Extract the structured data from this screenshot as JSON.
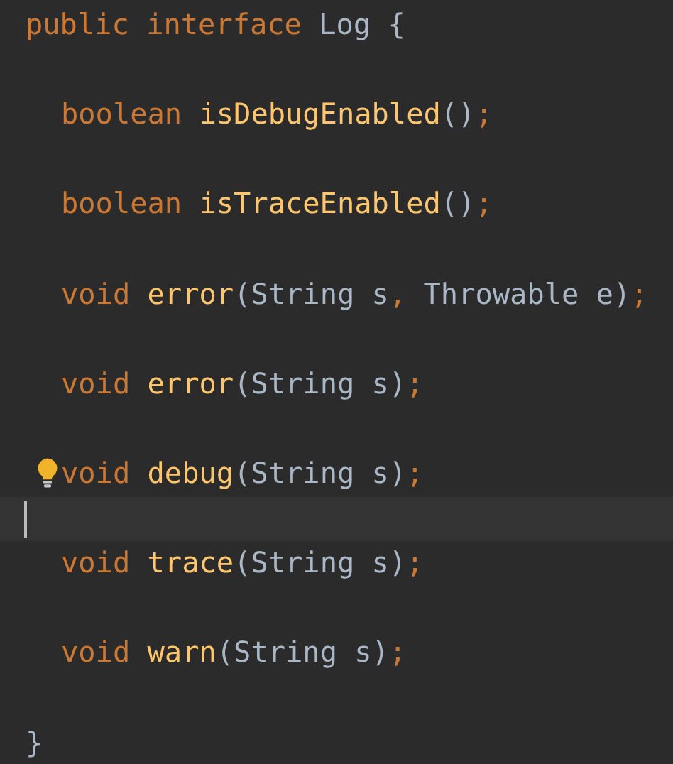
{
  "editor": {
    "lines": [
      {
        "kind": "code",
        "bulb": false,
        "tokens": [
          {
            "kind": "keyword",
            "text": "public interface "
          },
          {
            "kind": "plain",
            "text": "Log {"
          }
        ],
        "children": [
          {
            "kind": "blank"
          },
          {
            "kind": "code",
            "bulb": false,
            "tokens": [
              {
                "kind": "keyword",
                "text": "boolean "
              },
              {
                "kind": "method",
                "text": "isDebugEnabled"
              },
              {
                "kind": "plain",
                "text": "()"
              },
              {
                "kind": "keyword",
                "text": ";"
              }
            ]
          },
          {
            "kind": "blank"
          },
          {
            "kind": "code",
            "bulb": false,
            "tokens": [
              {
                "kind": "keyword",
                "text": "boolean "
              },
              {
                "kind": "method",
                "text": "isTraceEnabled"
              },
              {
                "kind": "plain",
                "text": "()"
              },
              {
                "kind": "keyword",
                "text": ";"
              }
            ]
          },
          {
            "kind": "blank"
          },
          {
            "kind": "code",
            "bulb": false,
            "tokens": [
              {
                "kind": "keyword",
                "text": "void "
              },
              {
                "kind": "method",
                "text": "error"
              },
              {
                "kind": "plain",
                "text": "(String s"
              },
              {
                "kind": "keyword",
                "text": ", "
              },
              {
                "kind": "plain",
                "text": "Throwable e)"
              },
              {
                "kind": "keyword",
                "text": ";"
              }
            ]
          },
          {
            "kind": "blank"
          },
          {
            "kind": "code",
            "bulb": false,
            "tokens": [
              {
                "kind": "keyword",
                "text": "void "
              },
              {
                "kind": "method",
                "text": "error"
              },
              {
                "kind": "plain",
                "text": "(String s)"
              },
              {
                "kind": "keyword",
                "text": ";"
              }
            ]
          },
          {
            "kind": "blank"
          },
          {
            "kind": "code",
            "bulb": true,
            "tokens": [
              {
                "kind": "keyword",
                "text": "void "
              },
              {
                "kind": "method",
                "text": "debug"
              },
              {
                "kind": "plain",
                "text": "(String s)"
              },
              {
                "kind": "keyword",
                "text": ";"
              }
            ]
          },
          {
            "kind": "cursor"
          },
          {
            "kind": "code",
            "bulb": false,
            "tokens": [
              {
                "kind": "keyword",
                "text": "void "
              },
              {
                "kind": "method",
                "text": "trace"
              },
              {
                "kind": "plain",
                "text": "(String s)"
              },
              {
                "kind": "keyword",
                "text": ";"
              }
            ]
          },
          {
            "kind": "blank"
          },
          {
            "kind": "code",
            "bulb": false,
            "tokens": [
              {
                "kind": "keyword",
                "text": "void "
              },
              {
                "kind": "method",
                "text": "warn"
              },
              {
                "kind": "plain",
                "text": "(String s)"
              },
              {
                "kind": "keyword",
                "text": ";"
              }
            ]
          },
          {
            "kind": "blank"
          }
        ]
      },
      {
        "kind": "code",
        "bulb": false,
        "tokens": [
          {
            "kind": "plain",
            "text": "}"
          }
        ]
      }
    ]
  }
}
